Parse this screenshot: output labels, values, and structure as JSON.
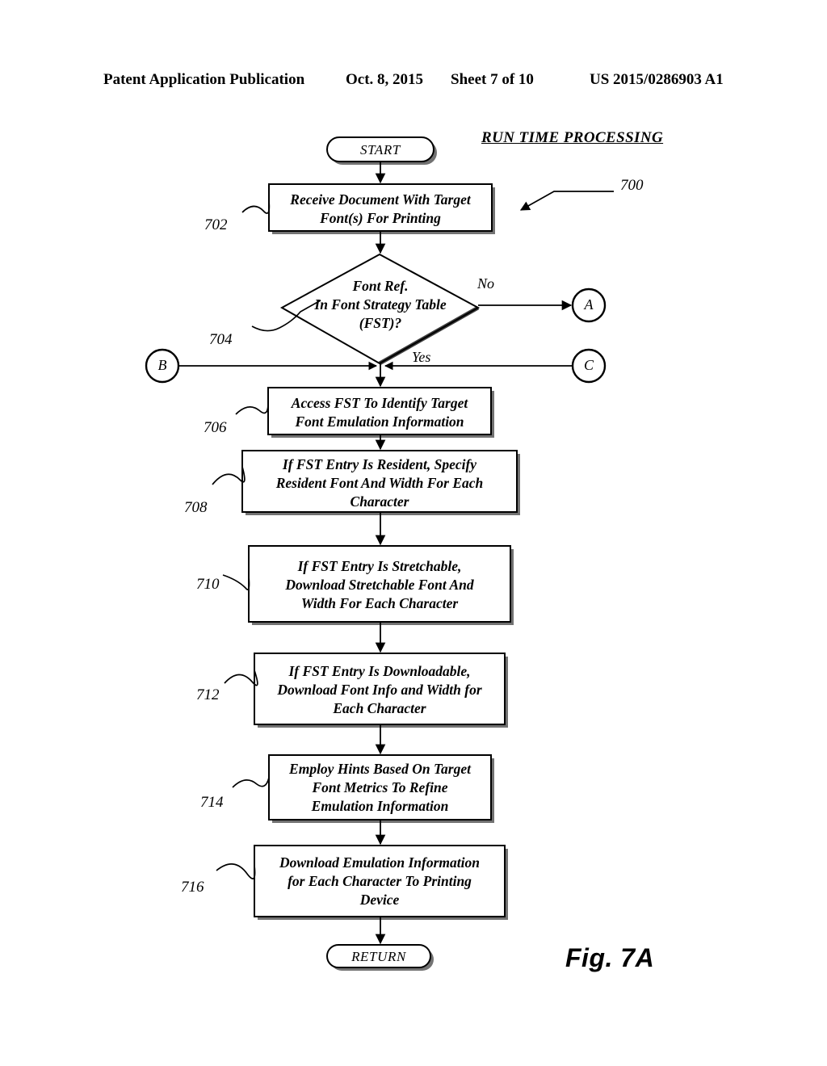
{
  "header": {
    "publication": "Patent Application Publication",
    "date": "Oct. 8, 2015",
    "sheet": "Sheet 7 of 10",
    "number": "US 2015/0286903 A1"
  },
  "figure": {
    "title": "RUN TIME PROCESSING",
    "caption": "Fig. 7A",
    "diagram_ref": "700"
  },
  "flowchart": {
    "start_label": "START",
    "return_label": "RETURN",
    "nodes": [
      {
        "ref": "702",
        "shape": "process",
        "lines": [
          "Receive Document With Target",
          "Font(s) For Printing"
        ]
      },
      {
        "ref": "704",
        "shape": "decision",
        "lines": [
          "Font Ref.",
          "In Font Strategy Table",
          "(FST)?"
        ]
      },
      {
        "ref": "706",
        "shape": "process",
        "lines": [
          "Access FST To Identify Target",
          "Font Emulation Information"
        ]
      },
      {
        "ref": "708",
        "shape": "process",
        "lines": [
          "If FST Entry Is Resident, Specify",
          "Resident Font And Width For Each",
          "Character"
        ]
      },
      {
        "ref": "710",
        "shape": "process",
        "lines": [
          "If FST Entry Is Stretchable,",
          "Download Stretchable Font And",
          "Width For Each Character"
        ]
      },
      {
        "ref": "712",
        "shape": "process",
        "lines": [
          "If FST Entry Is Downloadable,",
          "Download Font Info and Width for",
          "Each Character"
        ]
      },
      {
        "ref": "714",
        "shape": "process",
        "lines": [
          "Employ Hints Based On Target",
          "Font Metrics To Refine",
          "Emulation Information"
        ]
      },
      {
        "ref": "716",
        "shape": "process",
        "lines": [
          "Download Emulation Information",
          "for Each Character To Printing",
          "Device"
        ]
      }
    ],
    "edge_labels": {
      "no": "No",
      "yes": "Yes"
    },
    "connectors": [
      {
        "id": "A",
        "label": "A"
      },
      {
        "id": "B",
        "label": "B"
      },
      {
        "id": "C",
        "label": "C"
      }
    ]
  },
  "colors": {
    "ink": "#000000",
    "paper": "#ffffff",
    "shadow": "#4a4a4a"
  }
}
